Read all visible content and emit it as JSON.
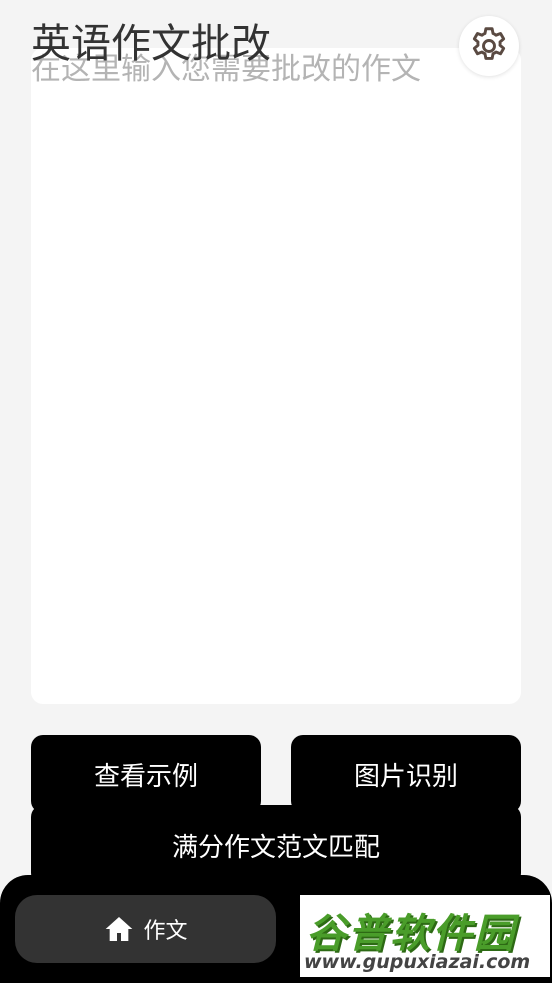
{
  "header": {
    "title": "英语作文批改",
    "settings_icon": "gear-icon"
  },
  "editor": {
    "placeholder": "在这里输入您需要批改的作文",
    "value": ""
  },
  "actions": {
    "example_label": "查看示例",
    "ocr_label": "图片识别",
    "match_label": "满分作文范文匹配"
  },
  "nav": {
    "items": [
      {
        "label": "作文",
        "icon": "home-icon",
        "active": true
      }
    ]
  },
  "watermark": {
    "main": "谷普软件园",
    "sub": "www.gupuxiazai.com"
  },
  "colors": {
    "background": "#f4f4f4",
    "button": "#000000",
    "nav_active": "#333333",
    "watermark_green": "#4a9d2a"
  }
}
